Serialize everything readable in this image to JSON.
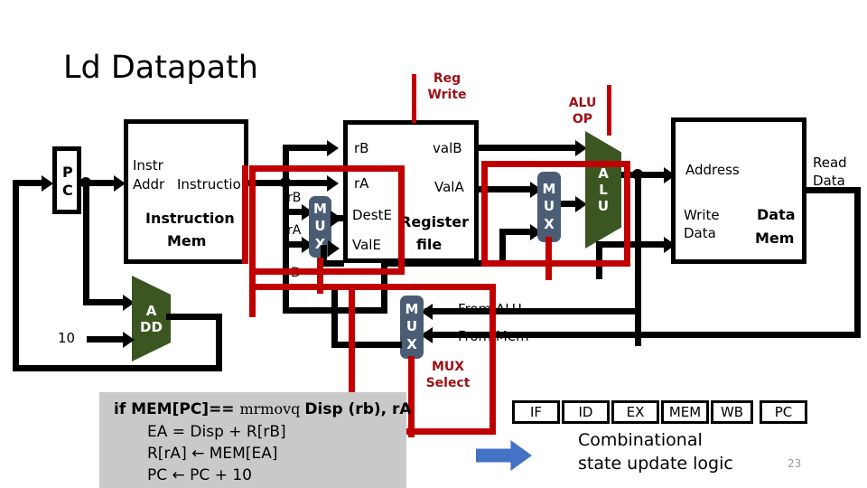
{
  "slide": {
    "title": "Ld Datapath",
    "page_number": "23",
    "background": "#FFFFFF",
    "accent_red": "#C00000",
    "label_red": "#9C1016",
    "mux_fill": "#4A5D75",
    "alu_fill": "#3C5622",
    "panel_gray": "#C9C9C9",
    "arrow_blue": "#4472C4"
  },
  "pc": {
    "label_line1": "P",
    "label_line2": "C"
  },
  "instruction_mem": {
    "input_line1": "Instr",
    "input_line2": "Addr",
    "output": "Instruction",
    "name_line1": "Instruction",
    "name_line2": "Mem"
  },
  "adder": {
    "label_line1": "A",
    "label_line2": "DD",
    "constant_input": "10"
  },
  "src_mux": {
    "letters": [
      "M",
      "U",
      "X"
    ],
    "input_top": "rB",
    "input_bottom": "rA",
    "input_extra": "D"
  },
  "register_file": {
    "inputs": [
      "rB",
      "rA",
      "DestE",
      "ValE"
    ],
    "outputs": [
      "valB",
      "ValA"
    ],
    "name_line1": "Register",
    "name_line2": "file"
  },
  "alu_mux": {
    "letters": [
      "M",
      "U",
      "X"
    ]
  },
  "alu": {
    "letters": [
      "A",
      "L",
      "U"
    ]
  },
  "data_mem": {
    "input_address": "Address",
    "input_write_line1": "Write",
    "input_write_line2": "Data",
    "name_line1": "Data",
    "name_line2": "Mem",
    "output_line1": "Read",
    "output_line2": "Data"
  },
  "wb_mux": {
    "letters": [
      "M",
      "U",
      "X"
    ],
    "input_top": "From ALU",
    "input_bottom": "From Mem"
  },
  "controls": [
    {
      "name": "reg-write",
      "text": "Reg\nWrite"
    },
    {
      "name": "alu-op",
      "text": "ALU\nOP"
    },
    {
      "name": "mux-select",
      "text": "MUX\nSelect"
    }
  ],
  "code": {
    "line1_pre": "if MEM[PC]== ",
    "line1_mnemonic": "mrmovq",
    "line1_post": "Disp (rb), rA",
    "line2": "EA = Disp + R[rB]",
    "line3": "R[rA] ← MEM[EA]",
    "line4": "PC ← PC + 10"
  },
  "stages": [
    "IF",
    "ID",
    "EX",
    "MEM",
    "WB",
    "PC"
  ],
  "footer": {
    "combinational_text": "Combinational\nstate update logic"
  }
}
